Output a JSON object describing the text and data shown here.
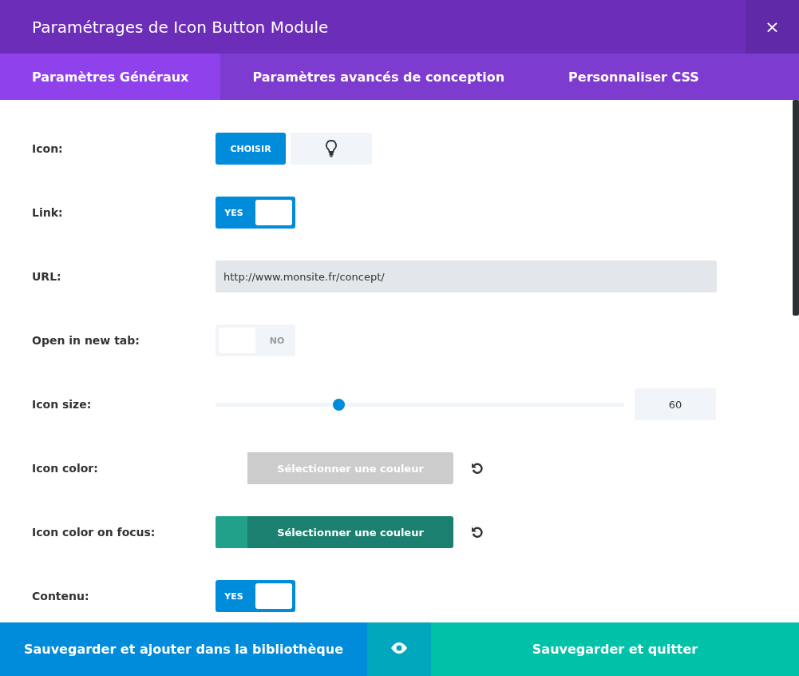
{
  "window": {
    "title": "Paramétrages de Icon Button Module",
    "close": "×"
  },
  "tabs": [
    {
      "label": "Paramètres Généraux",
      "selected": true
    },
    {
      "label": "Paramètres avancés de conception",
      "selected": false
    },
    {
      "label": "Personnaliser CSS",
      "selected": false
    }
  ],
  "settings": [
    {
      "kind": "icon",
      "label": "Icon:",
      "button": "CHOISIR"
    },
    {
      "kind": "toggle",
      "label": "Link:",
      "on": true,
      "on_text": "YES"
    },
    {
      "kind": "text",
      "label": "URL:",
      "value": "http://www.monsite.fr/concept/"
    },
    {
      "kind": "toggle",
      "label": "Open in new tab:",
      "on": false,
      "off_text": "NO"
    },
    {
      "kind": "slider",
      "label": "Icon size:",
      "level": 0.3,
      "value": "60"
    },
    {
      "kind": "color",
      "label": "Icon color:",
      "button": "Sélectionner une couleur"
    },
    {
      "kind": "color",
      "label": "Icon color on focus:",
      "button": "Sélectionner une couleur",
      "color": "#21a08a"
    },
    {
      "kind": "toggle",
      "label": "Contenu:",
      "on": true,
      "on_text": "YES"
    }
  ],
  "footer": {
    "save_library": "Sauvegarder et ajouter dans la bibliothèque",
    "save_quit": "Sauvegarder et quitter"
  }
}
